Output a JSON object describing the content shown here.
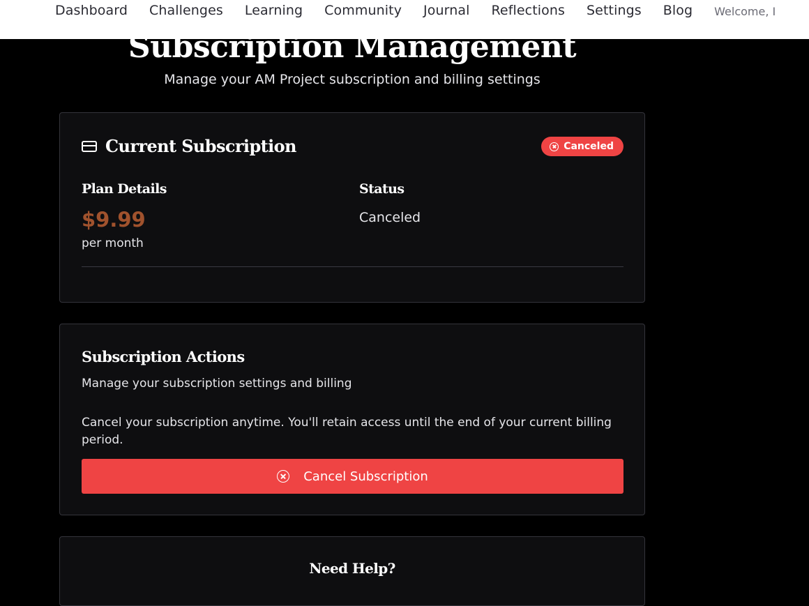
{
  "nav": {
    "links": [
      "Dashboard",
      "Challenges",
      "Learning",
      "Community",
      "Journal",
      "Reflections",
      "Settings",
      "Blog"
    ],
    "welcome": "Welcome, I"
  },
  "header": {
    "title": "Subscription Management",
    "subtitle": "Manage your AM Project subscription and billing settings"
  },
  "current_subscription": {
    "title": "Current Subscription",
    "icon": "credit-card-icon",
    "badge": "Canceled",
    "badge_color": "#ef4444",
    "plan_label": "Plan Details",
    "price": "$9.99",
    "price_color": "#a0522d",
    "period": "per month",
    "status_label": "Status",
    "status_value": "Canceled"
  },
  "subscription_actions": {
    "title": "Subscription Actions",
    "description": "Manage your subscription settings and billing",
    "note": "Cancel your subscription anytime. You'll retain access until the end of your current billing period.",
    "cancel_button": "Cancel Subscription",
    "cancel_button_color": "#ef4444"
  },
  "help": {
    "title": "Need Help?"
  }
}
